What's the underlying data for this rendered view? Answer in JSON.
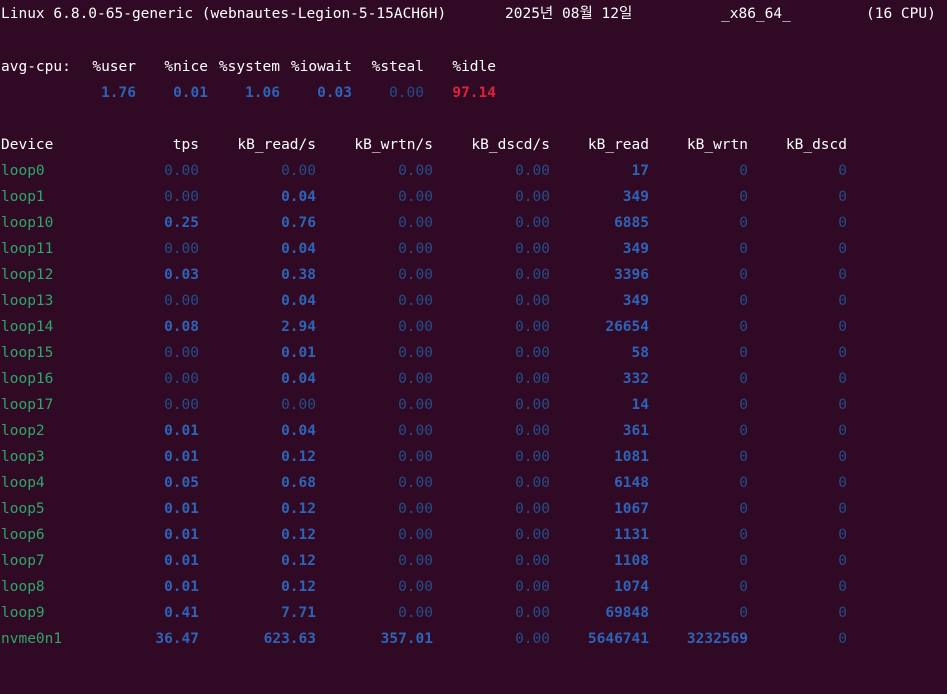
{
  "sysline": {
    "kernel": "Linux 6.8.0-65-generic (webnautes-Legion-5-15ACH6H)",
    "date": "2025년 08월 12일",
    "arch": "_x86_64_",
    "cpus": "(16 CPU)"
  },
  "cpu": {
    "label": "avg-cpu:",
    "headers": [
      "%user",
      "%nice",
      "%system",
      "%iowait",
      "%steal",
      "%idle"
    ],
    "values": [
      "1.76",
      "0.01",
      "1.06",
      "0.03",
      "0.00",
      "97.14"
    ]
  },
  "devices": {
    "headers": [
      "Device",
      "tps",
      "kB_read/s",
      "kB_wrtn/s",
      "kB_dscd/s",
      "kB_read",
      "kB_wrtn",
      "kB_dscd"
    ],
    "rows": [
      [
        "loop0",
        "0.00",
        "0.00",
        "0.00",
        "0.00",
        "17",
        "0",
        "0"
      ],
      [
        "loop1",
        "0.00",
        "0.04",
        "0.00",
        "0.00",
        "349",
        "0",
        "0"
      ],
      [
        "loop10",
        "0.25",
        "0.76",
        "0.00",
        "0.00",
        "6885",
        "0",
        "0"
      ],
      [
        "loop11",
        "0.00",
        "0.04",
        "0.00",
        "0.00",
        "349",
        "0",
        "0"
      ],
      [
        "loop12",
        "0.03",
        "0.38",
        "0.00",
        "0.00",
        "3396",
        "0",
        "0"
      ],
      [
        "loop13",
        "0.00",
        "0.04",
        "0.00",
        "0.00",
        "349",
        "0",
        "0"
      ],
      [
        "loop14",
        "0.08",
        "2.94",
        "0.00",
        "0.00",
        "26654",
        "0",
        "0"
      ],
      [
        "loop15",
        "0.00",
        "0.01",
        "0.00",
        "0.00",
        "58",
        "0",
        "0"
      ],
      [
        "loop16",
        "0.00",
        "0.04",
        "0.00",
        "0.00",
        "332",
        "0",
        "0"
      ],
      [
        "loop17",
        "0.00",
        "0.00",
        "0.00",
        "0.00",
        "14",
        "0",
        "0"
      ],
      [
        "loop2",
        "0.01",
        "0.04",
        "0.00",
        "0.00",
        "361",
        "0",
        "0"
      ],
      [
        "loop3",
        "0.01",
        "0.12",
        "0.00",
        "0.00",
        "1081",
        "0",
        "0"
      ],
      [
        "loop4",
        "0.05",
        "0.68",
        "0.00",
        "0.00",
        "6148",
        "0",
        "0"
      ],
      [
        "loop5",
        "0.01",
        "0.12",
        "0.00",
        "0.00",
        "1067",
        "0",
        "0"
      ],
      [
        "loop6",
        "0.01",
        "0.12",
        "0.00",
        "0.00",
        "1131",
        "0",
        "0"
      ],
      [
        "loop7",
        "0.01",
        "0.12",
        "0.00",
        "0.00",
        "1108",
        "0",
        "0"
      ],
      [
        "loop8",
        "0.01",
        "0.12",
        "0.00",
        "0.00",
        "1074",
        "0",
        "0"
      ],
      [
        "loop9",
        "0.41",
        "7.71",
        "0.00",
        "0.00",
        "69848",
        "0",
        "0"
      ],
      [
        "nvme0n1",
        "36.47",
        "623.63",
        "357.01",
        "0.00",
        "5646741",
        "3232569",
        "0"
      ]
    ]
  },
  "colors": {
    "background": "#300a24",
    "device_name": "#2fa66a",
    "nonzero_value": "#2e63b8",
    "zero_value": "#244d8a",
    "idle_highlight": "#e0233a"
  }
}
